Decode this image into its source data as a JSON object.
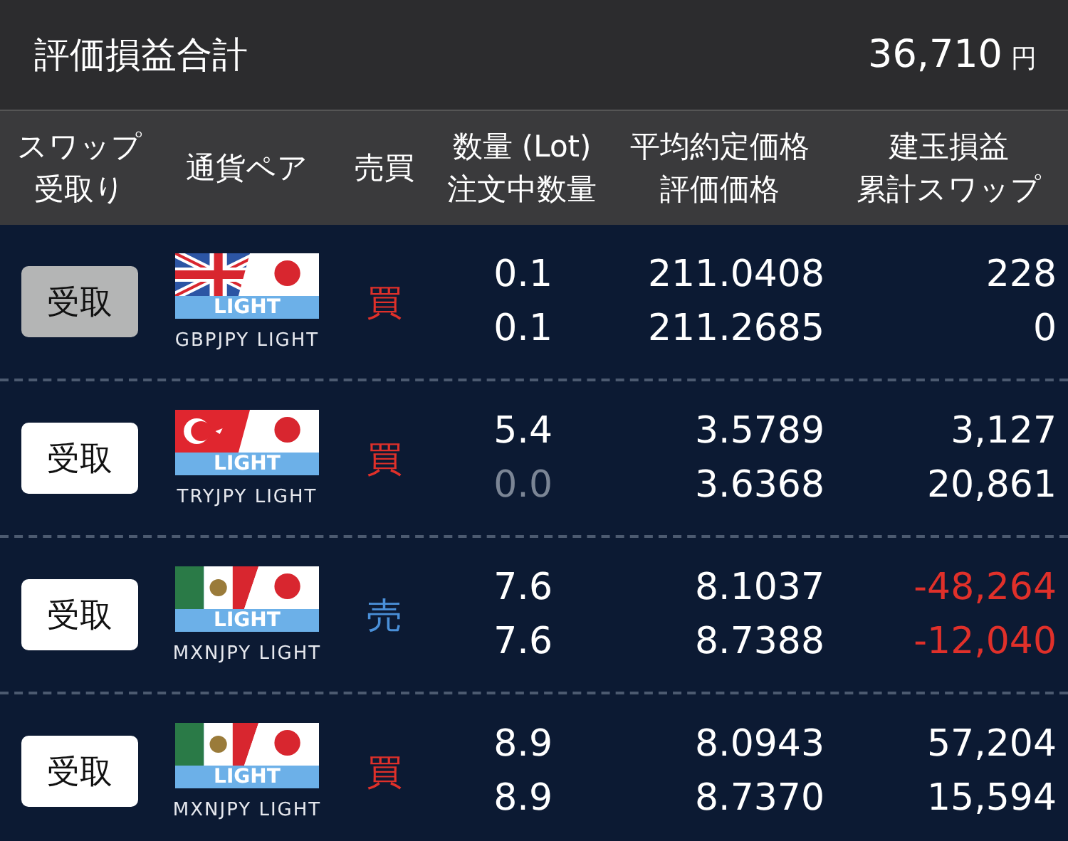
{
  "summary": {
    "label": "評価損益合計",
    "value": "36,710",
    "unit": "円"
  },
  "columns": [
    {
      "lines": [
        "スワップ",
        "受取り"
      ]
    },
    {
      "lines": [
        "通貨ペア"
      ]
    },
    {
      "lines": [
        "売買"
      ]
    },
    {
      "lines": [
        "数量 (Lot)",
        "注文中数量"
      ]
    },
    {
      "lines": [
        "平均約定価格",
        "評価価格"
      ]
    },
    {
      "lines": [
        "建玉損益",
        "累計スワップ"
      ]
    }
  ],
  "rows": [
    {
      "button": {
        "label": "受取",
        "disabled": true
      },
      "flag": {
        "kind": "gb",
        "badge": "LIGHT"
      },
      "pair": "GBPJPY LIGHT",
      "side": {
        "label": "買",
        "kind": "buy"
      },
      "qty": "0.1",
      "pending": {
        "text": "0.1",
        "dimmed": false
      },
      "avg_price": "211.0408",
      "eval_price": "211.2685",
      "pnl": {
        "text": "228",
        "negative": false
      },
      "swap": {
        "text": "0",
        "negative": false
      }
    },
    {
      "button": {
        "label": "受取",
        "disabled": false
      },
      "flag": {
        "kind": "tr",
        "badge": "LIGHT"
      },
      "pair": "TRYJPY LIGHT",
      "side": {
        "label": "買",
        "kind": "buy"
      },
      "qty": "5.4",
      "pending": {
        "text": "0.0",
        "dimmed": true
      },
      "avg_price": "3.5789",
      "eval_price": "3.6368",
      "pnl": {
        "text": "3,127",
        "negative": false
      },
      "swap": {
        "text": "20,861",
        "negative": false
      }
    },
    {
      "button": {
        "label": "受取",
        "disabled": false
      },
      "flag": {
        "kind": "mx",
        "badge": "LIGHT"
      },
      "pair": "MXNJPY LIGHT",
      "side": {
        "label": "売",
        "kind": "sell"
      },
      "qty": "7.6",
      "pending": {
        "text": "7.6",
        "dimmed": false
      },
      "avg_price": "8.1037",
      "eval_price": "8.7388",
      "pnl": {
        "text": "-48,264",
        "negative": true
      },
      "swap": {
        "text": "-12,040",
        "negative": true
      }
    },
    {
      "button": {
        "label": "受取",
        "disabled": false
      },
      "flag": {
        "kind": "mx",
        "badge": "LIGHT"
      },
      "pair": "MXNJPY LIGHT",
      "side": {
        "label": "買",
        "kind": "buy"
      },
      "qty": "8.9",
      "pending": {
        "text": "8.9",
        "dimmed": false
      },
      "avg_price": "8.0943",
      "eval_price": "8.7370",
      "pnl": {
        "text": "57,204",
        "negative": false
      },
      "swap": {
        "text": "15,594",
        "negative": false
      }
    }
  ]
}
